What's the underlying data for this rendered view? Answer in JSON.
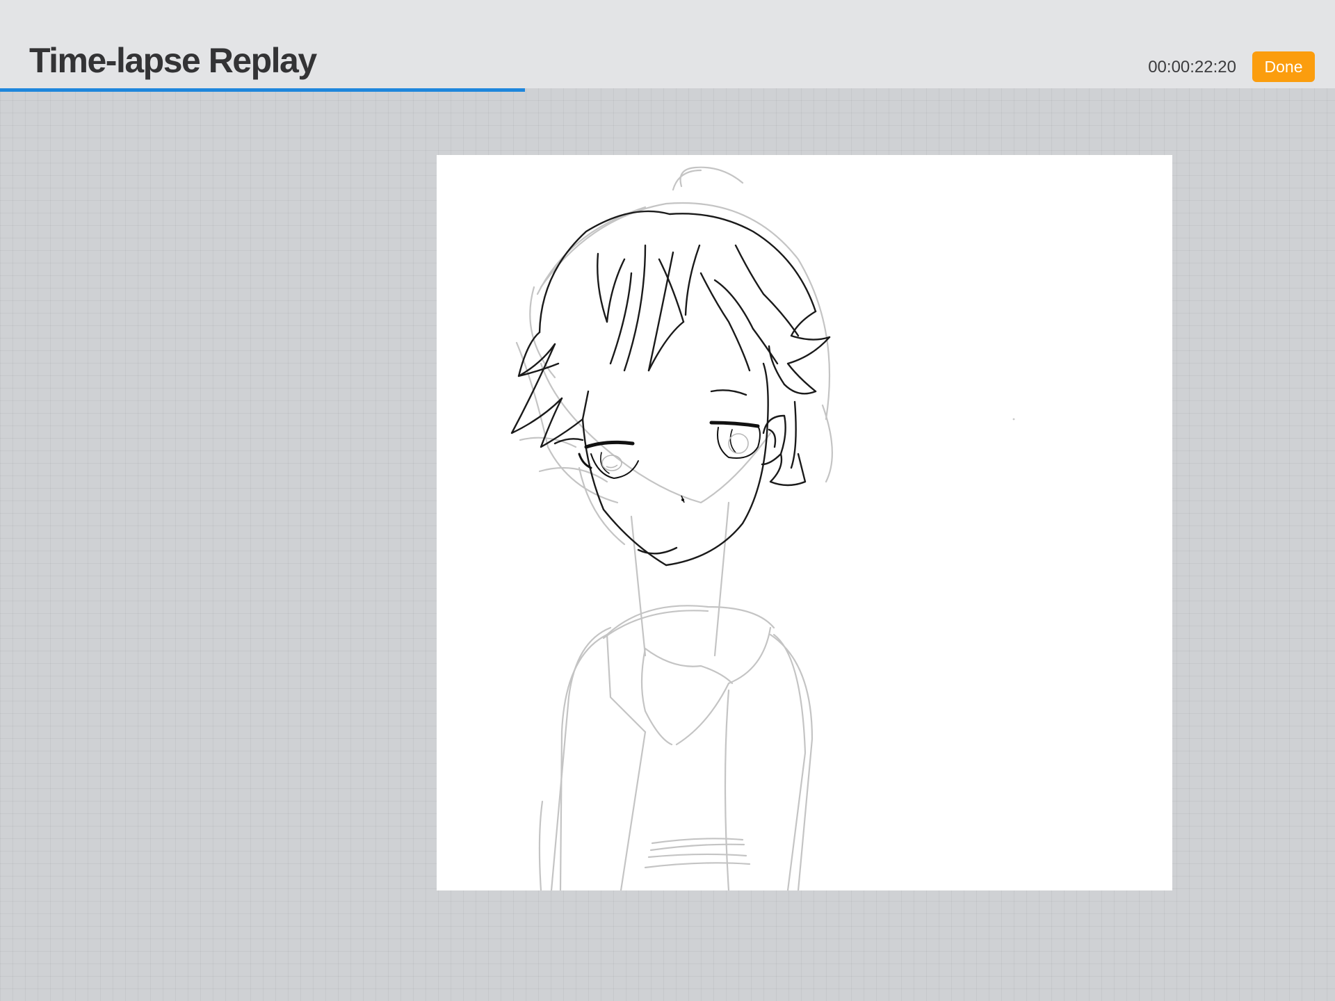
{
  "header": {
    "title": "Time-lapse Replay",
    "timestamp": "00:00:22:20",
    "done_label": "Done"
  },
  "playback": {
    "progress": 0.393
  },
  "colors": {
    "accent": "#1e86dc",
    "done_button": "#fb9d0e",
    "background": "#cfd1d4",
    "header_bg": "#e3e4e6"
  },
  "canvas": {
    "content": "anime-boy-sketch-drawing"
  }
}
